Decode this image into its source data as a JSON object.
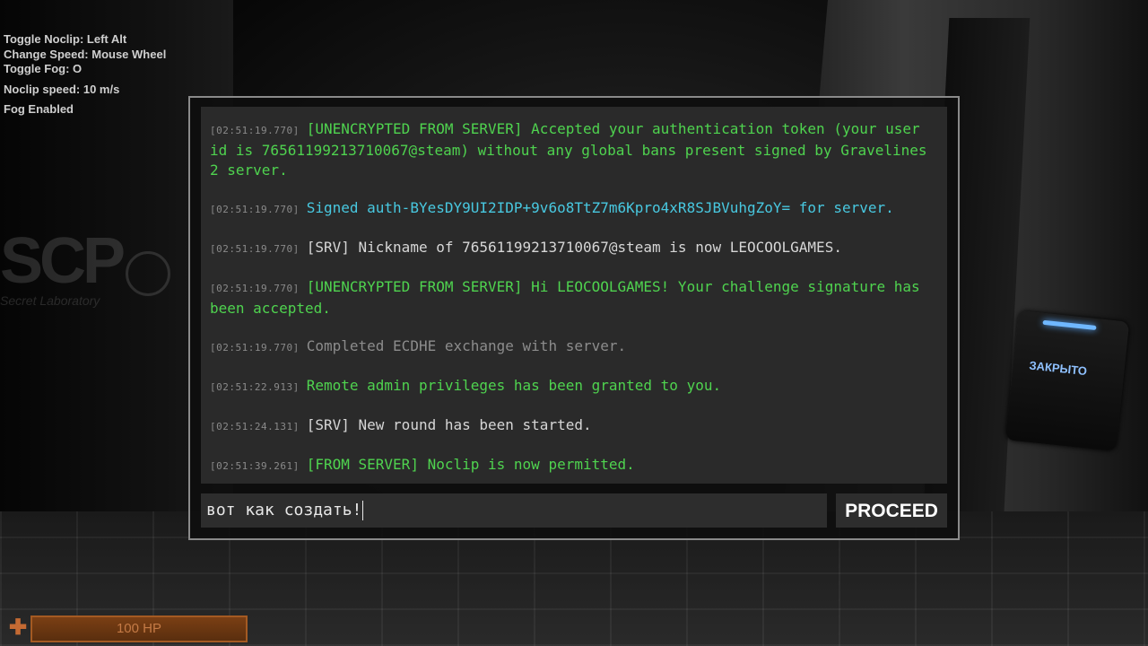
{
  "hud": {
    "toggle_noclip": "Toggle Noclip: Left Alt",
    "change_speed": "Change Speed: Mouse Wheel",
    "toggle_fog": "Toggle Fog: O",
    "noclip_speed": "Noclip speed: 10 m/s",
    "fog_status": "Fog Enabled",
    "hp_text": "100 HP",
    "hp_fraction": 1.0
  },
  "world": {
    "door_panel_label": "ЗАКРЫТО",
    "logo_text": "SCP",
    "logo_subtext": "Secret Laboratory"
  },
  "console": {
    "entries": [
      {
        "time": "[02:51:19.770]",
        "text": "[UNENCRYPTED FROM SERVER] Accepted your authentication token (your user id is 76561199213710067@steam) without any global bans present signed by Gravelines 2 server.",
        "color": "green"
      },
      {
        "time": "[02:51:19.770]",
        "text": "Signed auth-BYesDY9UI2IDP+9v6o8TtZ7m6Kpro4xR8SJBVuhgZoY= for server.",
        "color": "cyan"
      },
      {
        "time": "[02:51:19.770]",
        "text": "[SRV] Nickname of 76561199213710067@steam is now LEOCOOLGAMES.",
        "color": "white"
      },
      {
        "time": "[02:51:19.770]",
        "text": "[UNENCRYPTED FROM SERVER] Hi LEOCOOLGAMES! Your challenge signature has been accepted.",
        "color": "green"
      },
      {
        "time": "[02:51:19.770]",
        "text": "Completed ECDHE exchange with server.",
        "color": "gray"
      },
      {
        "time": "[02:51:22.913]",
        "text": "Remote admin privileges has been granted to you.",
        "color": "green"
      },
      {
        "time": "[02:51:24.131]",
        "text": "[SRV] New round has been started.",
        "color": "white"
      },
      {
        "time": "[02:51:39.261]",
        "text": "[FROM SERVER] Noclip is now permitted.",
        "color": "green"
      }
    ],
    "input_value": "вот как создать!",
    "proceed_label": "PROCEED"
  },
  "colors": {
    "green": "#4fd34f",
    "cyan": "#48c8e0",
    "white": "#d6d6d6",
    "gray": "#8c8c8c",
    "hp": "#a45a22"
  }
}
